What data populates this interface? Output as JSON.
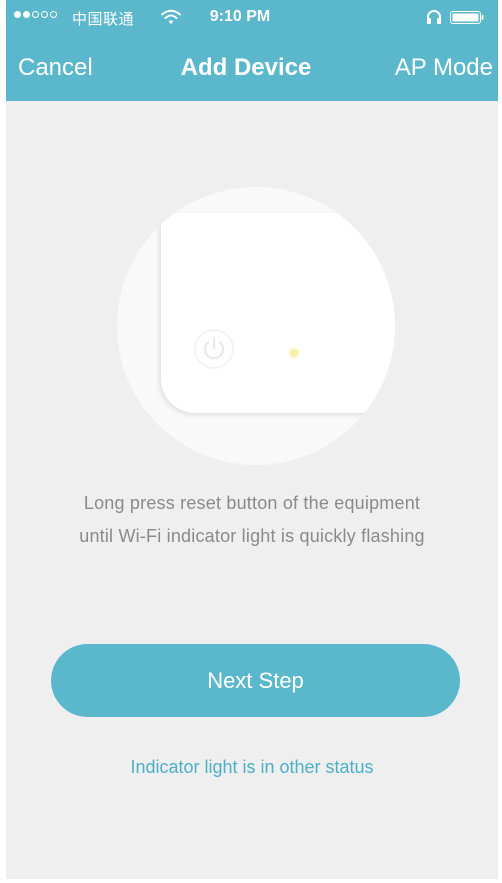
{
  "status_bar": {
    "signal_filled": 2,
    "signal_total": 5,
    "carrier": "中国联通",
    "time": "9:10 PM",
    "icons": [
      "wifi-icon",
      "headphone-icon",
      "battery-icon"
    ]
  },
  "nav": {
    "left_label": "Cancel",
    "title": "Add Device",
    "right_label": "AP Mode"
  },
  "illustration": {
    "icons": [
      "power-icon",
      "indicator-led-icon"
    ]
  },
  "instruction": {
    "line1": "Long press reset button of the equipment",
    "line2": "until Wi-Fi indicator light is quickly flashing"
  },
  "next_button_label": "Next Step",
  "other_status_link": "Indicator light is in other status",
  "colors": {
    "accent": "#5bb8cc",
    "background": "#efefef",
    "text_muted": "#8a8a8a",
    "link": "#4cb0c8"
  }
}
